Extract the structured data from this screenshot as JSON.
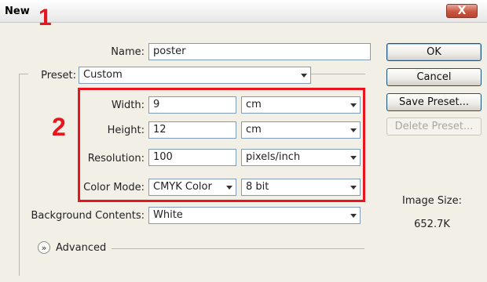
{
  "dialog": {
    "title": "New",
    "close_label": "X"
  },
  "annotations": {
    "one": "1",
    "two": "2"
  },
  "form": {
    "name_label": "Name:",
    "name_value": "poster",
    "preset_label": "Preset:",
    "preset_value": "Custom",
    "width_label": "Width:",
    "width_value": "9",
    "width_unit": "cm",
    "height_label": "Height:",
    "height_value": "12",
    "height_unit": "cm",
    "resolution_label": "Resolution:",
    "resolution_value": "100",
    "resolution_unit": "pixels/inch",
    "color_mode_label": "Color Mode:",
    "color_mode_value": "CMYK Color",
    "bit_depth_value": "8 bit",
    "background_label": "Background Contents:",
    "background_value": "White",
    "advanced_label": "Advanced"
  },
  "buttons": {
    "ok": "OK",
    "cancel": "Cancel",
    "save_preset": "Save Preset...",
    "delete_preset": "Delete Preset..."
  },
  "image_size": {
    "label": "Image Size:",
    "value": "652.7K"
  },
  "colors": {
    "highlight": "#e8141e",
    "close": "#c8553f"
  }
}
